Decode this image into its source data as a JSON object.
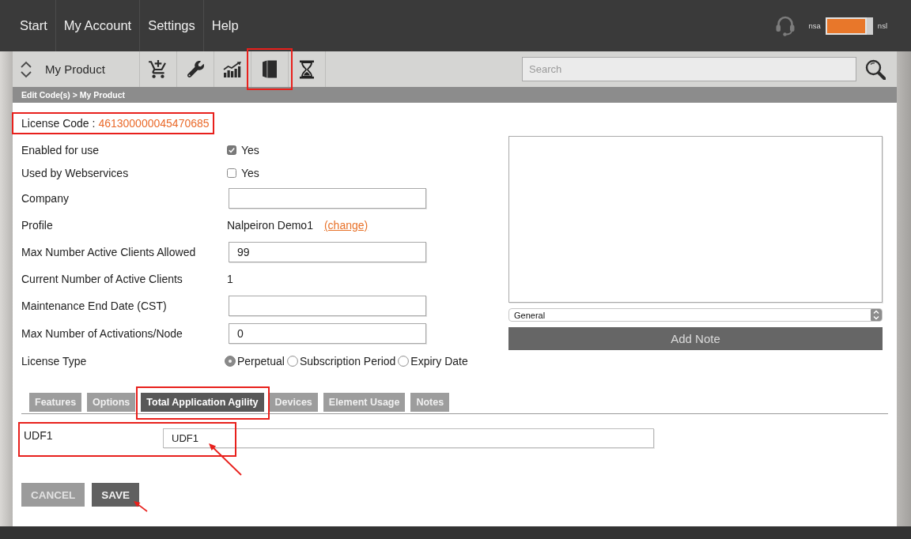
{
  "nav": {
    "items": [
      "Start",
      "My Account",
      "Settings",
      "Help"
    ],
    "switch": {
      "left_label": "nsa",
      "right_label": "nsl",
      "on": true
    }
  },
  "toolbar": {
    "product": "My Product",
    "search": {
      "placeholder": "Search"
    }
  },
  "breadcrumb": "Edit Code(s) > My Product",
  "license_code": {
    "label": "License Code :",
    "value": "461300000045470685"
  },
  "fields": [
    {
      "kind": "checkbox",
      "label": "Enabled for use",
      "option": "Yes",
      "checked": true
    },
    {
      "kind": "checkbox",
      "label": "Used by Webservices",
      "option": "Yes",
      "checked": false
    },
    {
      "kind": "input",
      "label": "Company"
    },
    {
      "kind": "link",
      "label": "Profile",
      "value": "Nalpeiron Demo1",
      "link": "(change)"
    },
    {
      "kind": "input",
      "label": "Max Number Active Clients Allowed",
      "value": "99"
    },
    {
      "kind": "text",
      "label": "Current Number of Active Clients",
      "value": "1"
    },
    {
      "kind": "input",
      "label": "Maintenance End Date (CST)"
    },
    {
      "kind": "input",
      "label": "Max Number of Activations/Node",
      "value": "0"
    },
    {
      "kind": "radio",
      "label": "License Type",
      "options": [
        {
          "label": "Perpetual",
          "selected": true
        },
        {
          "label": "Subscription Period",
          "selected": false
        },
        {
          "label": "Expiry Date",
          "selected": false
        }
      ]
    }
  ],
  "notes": {
    "category": "General",
    "add_button": "Add Note"
  },
  "tabs": [
    {
      "label": "Features",
      "selected": false
    },
    {
      "label": "Options",
      "selected": false
    },
    {
      "label": "Total Application Agility",
      "selected": true
    },
    {
      "label": "Devices",
      "selected": false
    },
    {
      "label": "Element Usage",
      "selected": false
    },
    {
      "label": "Notes",
      "selected": false
    }
  ],
  "udf": {
    "label": "UDF1",
    "value": "UDF1"
  },
  "buttons": [
    {
      "label": "CANCEL",
      "kind": "cancel"
    },
    {
      "label": "SAVE",
      "kind": "save"
    }
  ]
}
